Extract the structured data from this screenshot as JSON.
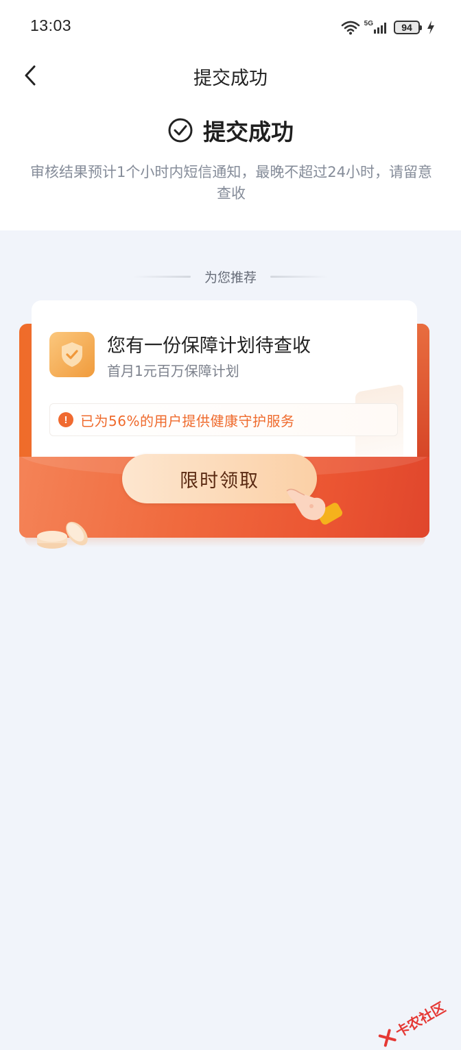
{
  "status_bar": {
    "time": "13:03",
    "network": "5G",
    "battery": "94",
    "icons": [
      "wifi-icon",
      "cellular-signal-icon",
      "battery-icon",
      "charging-icon"
    ]
  },
  "nav": {
    "back_icon": "chevron-left-icon",
    "title": "提交成功"
  },
  "success": {
    "icon": "check-circle-icon",
    "title": "提交成功",
    "description": "审核结果预计1个小时内短信通知，最晚不超过24小时，请留意查收"
  },
  "recommend": {
    "label": "为您推荐"
  },
  "card": {
    "icon": "shield-check-icon",
    "title": "您有一份保障计划待查收",
    "subtitle": "首月1元百万保障计划",
    "notice": "已为56%的用户提供健康守护服务",
    "button_label": "限时领取"
  },
  "watermark": {
    "text": "卡农社区"
  },
  "colors": {
    "accent": "#ef6a2c",
    "card_red": "#e45030",
    "background": "#f1f4fa"
  }
}
